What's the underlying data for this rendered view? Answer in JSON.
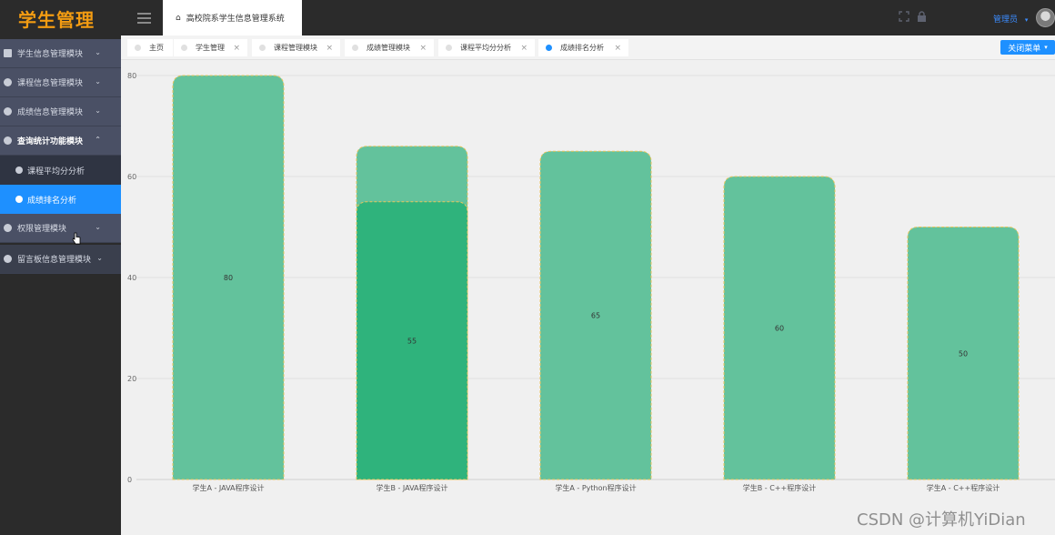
{
  "app": {
    "logo": "学生管理",
    "system_title": "高校院系学生信息管理系统",
    "admin_label": "管理员",
    "admin_caret": "▾",
    "close_menu": "关闭菜单",
    "close_menu_caret": "▾",
    "watermark": "CSDN @计算机YiDian"
  },
  "sidebar": {
    "items": [
      {
        "label": "学生信息管理模块",
        "chev": "⌄"
      },
      {
        "label": "课程信息管理模块",
        "chev": "⌄"
      },
      {
        "label": "成绩信息管理模块",
        "chev": "⌄"
      },
      {
        "label": "查询统计功能模块",
        "chev": "⌃"
      },
      {
        "label": "权限管理模块",
        "chev": "⌄"
      },
      {
        "label": "留言板信息管理模块",
        "chev": "⌄"
      }
    ],
    "sub_items": [
      {
        "label": "课程平均分分析"
      },
      {
        "label": "成绩排名分析"
      }
    ]
  },
  "tabs": [
    {
      "label": "主页",
      "close": ""
    },
    {
      "label": "学生管理",
      "close": "×"
    },
    {
      "label": "课程管理模块",
      "close": "×"
    },
    {
      "label": "成绩管理模块",
      "close": "×"
    },
    {
      "label": "课程平均分分析",
      "close": "×"
    },
    {
      "label": "成绩排名分析",
      "close": "×"
    }
  ],
  "colors": {
    "bar": "#63c29c",
    "bar_dark": "#2fb37c",
    "bar_border": "#e6c45a",
    "accent": "#1e90ff"
  },
  "chart_data": {
    "type": "bar",
    "categories": [
      "学生A - JAVA程序设计",
      "学生B - JAVA程序设计",
      "学生A - Python程序设计",
      "学生B - C++程序设计",
      "学生A - C++程序设计"
    ],
    "series": [
      {
        "values": [
          80,
          66,
          65,
          60,
          50
        ]
      },
      {
        "values": [
          null,
          55,
          null,
          null,
          null
        ]
      }
    ],
    "data_labels": [
      "80",
      "55",
      "65",
      "60",
      "50"
    ],
    "yticks": [
      0,
      20,
      40,
      60,
      80
    ],
    "ylim": [
      0,
      80
    ],
    "grid": true
  }
}
